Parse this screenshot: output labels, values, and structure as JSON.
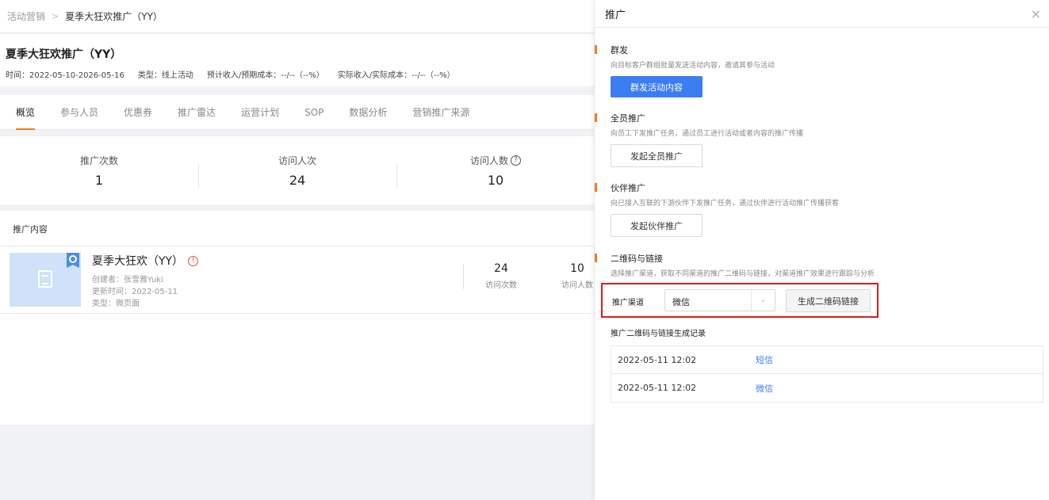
{
  "breadcrumb": {
    "parent": "活动营销",
    "separator": ">",
    "current": "夏季大狂欢推广（YY）"
  },
  "header": {
    "title": "夏季大狂欢推广（YY）",
    "meta": [
      "时间：2022-05-10-2026-05-16",
      "类型：线上活动",
      "预计收入/预期成本：--/--（--%）",
      "实际收入/实际成本：--/--（--%）"
    ]
  },
  "tabs": [
    "概览",
    "参与人员",
    "优惠券",
    "推广雷达",
    "运营计划",
    "SOP",
    "数据分析",
    "营销推广来源"
  ],
  "active_tab": "概览",
  "stats": [
    {
      "label": "推广次数",
      "value": "1"
    },
    {
      "label": "访问人次",
      "value": "24"
    },
    {
      "label": "访问人数",
      "value": "10"
    }
  ],
  "content": {
    "section_title": "推广内容",
    "item": {
      "title": "夏季大狂欢（YY）",
      "creator": "创建者：张雪雅Yuki",
      "updated": "更新时间：2022-05-11",
      "type": "类型：微页面",
      "stats": [
        {
          "value": "24",
          "label": "访问次数"
        },
        {
          "value": "10",
          "label": "访问人数"
        }
      ]
    }
  },
  "drawer": {
    "title": "推广",
    "close": "×",
    "sections": [
      {
        "title": "群发",
        "desc": "向目标客户群组批量发送活动内容，邀请其参与活动",
        "button": "群发活动内容"
      },
      {
        "title": "全员推广",
        "desc": "向员工下发推广任务，通过员工进行活动或者内容的推广传播",
        "button": "发起全员推广"
      },
      {
        "title": "伙伴推广",
        "desc": "向已接入互联的下游伙伴下发推广任务，通过伙伴进行活动推广传播获客",
        "button": "发起伙伴推广"
      },
      {
        "title": "二维码与链接",
        "desc": "选择推广渠道，获取不同渠道的推广二维码与链接，对渠道推广效果进行跟踪与分析"
      }
    ],
    "channel": {
      "label": "推广渠道",
      "selected": "微信",
      "generate_button": "生成二维码链接"
    },
    "records": {
      "title": "推广二维码与链接生成记录",
      "rows": [
        {
          "time": "2022-05-11 12:02",
          "channel": "短信"
        },
        {
          "time": "2022-05-11 12:02",
          "channel": "微信"
        }
      ]
    }
  },
  "colors": {
    "accent_orange": "#f37b1d",
    "primary_blue": "#3b7ef4",
    "highlight_red": "#d91e18"
  }
}
